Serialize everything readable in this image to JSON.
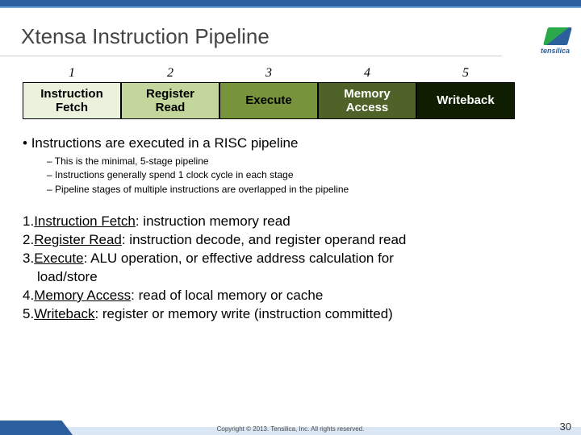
{
  "brand": {
    "name": "tensilica"
  },
  "title": "Xtensa Instruction Pipeline",
  "stages": [
    {
      "num": "1",
      "label": "Instruction\nFetch"
    },
    {
      "num": "2",
      "label": "Register\nRead"
    },
    {
      "num": "3",
      "label": "Execute"
    },
    {
      "num": "4",
      "label": "Memory\nAccess"
    },
    {
      "num": "5",
      "label": "Writeback"
    }
  ],
  "bullet_main": "Instructions are executed in a RISC pipeline",
  "sub_bullets": [
    "This is the minimal, 5-stage pipeline",
    "Instructions generally spend 1 clock cycle in each stage",
    "Pipeline stages of multiple instructions are overlapped in the pipeline"
  ],
  "defs": [
    {
      "n": "1.",
      "term": "Instruction Fetch",
      "desc": ": instruction memory read"
    },
    {
      "n": "2.",
      "term": "Register Read",
      "desc": ": instruction decode, and register operand read"
    },
    {
      "n": "3.",
      "term": "Execute",
      "desc": ": ALU operation, or effective address calculation for"
    },
    {
      "cont": "load/store"
    },
    {
      "n": "4.",
      "term": "Memory Access",
      "desc": ": read of local memory or cache"
    },
    {
      "n": "5.",
      "term": "Writeback",
      "desc": ": register or memory write (instruction committed)"
    }
  ],
  "footer": {
    "copyright": "Copyright © 2013. Tensilica, Inc. All rights reserved.",
    "page": "30"
  }
}
